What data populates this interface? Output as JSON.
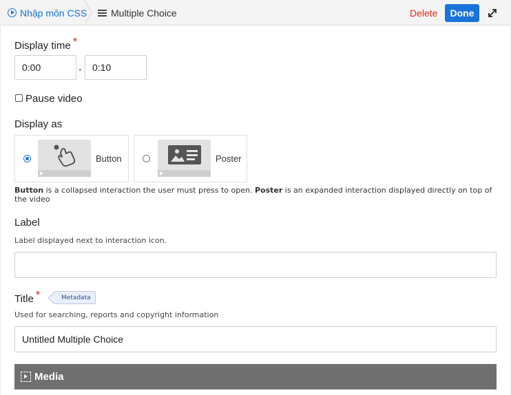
{
  "topbar": {
    "home_label": "Nhập môn CSS",
    "current_label": "Multiple Choice",
    "delete_label": "Delete",
    "done_label": "Done"
  },
  "display_time": {
    "label": "Display time",
    "required_mark": "*",
    "from_value": "0:00",
    "separator": "-",
    "to_value": "0:10"
  },
  "pause_video": {
    "label": "Pause video",
    "checked": false
  },
  "display_as": {
    "label": "Display as",
    "options": [
      {
        "label": "Button",
        "selected": true
      },
      {
        "label": "Poster",
        "selected": false
      }
    ],
    "help_button_term": "Button",
    "help_middle": " is a collapsed interaction the user must press to open. ",
    "help_poster_term": "Poster",
    "help_end": " is an expanded interaction displayed directly on top of the video"
  },
  "label_field": {
    "label": "Label",
    "description": "Label displayed next to interaction icon.",
    "value": ""
  },
  "title_field": {
    "label": "Title",
    "required_mark": "*",
    "metadata_tag": "Metadata",
    "description": "Used for searching, reports and copyright information",
    "value": "Untitled Multiple Choice"
  },
  "media_section": {
    "label": "Media"
  },
  "colors": {
    "accent": "#1a73d9",
    "danger": "#d9301c",
    "media_bar": "#6f6f6f"
  }
}
